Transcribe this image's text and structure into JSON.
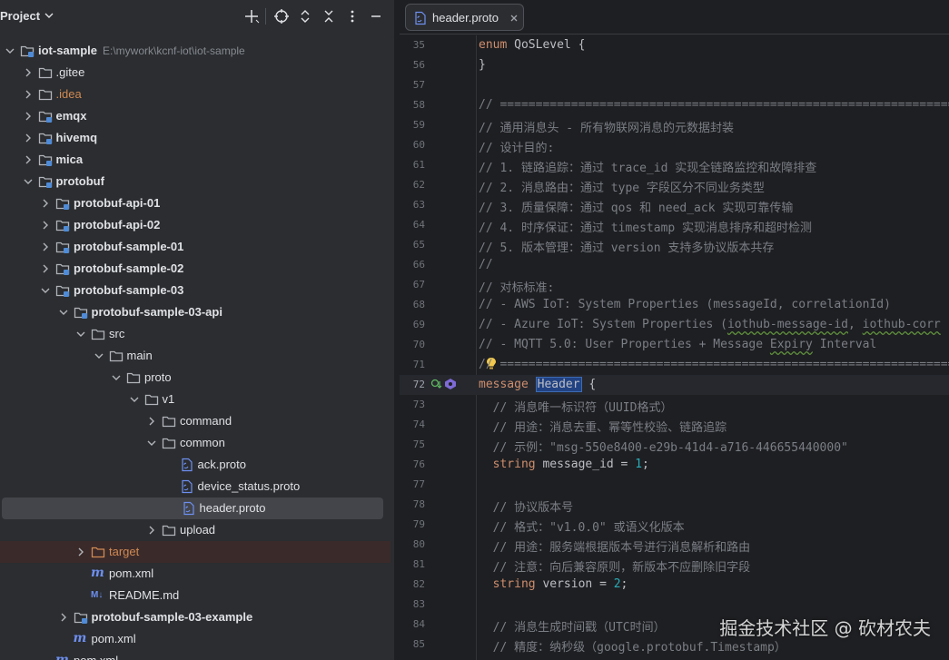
{
  "panel": {
    "title": "Project",
    "header_icons": [
      "plus-icon",
      "crosshair-icon",
      "expand-all-icon",
      "collapse-all-icon",
      "more-icon",
      "minimize-icon"
    ]
  },
  "tree": [
    {
      "label": "iot-sample",
      "path": "E:\\mywork\\kcnf-iot\\iot-sample",
      "depth": 0,
      "chevron": "down",
      "icon": "module-folder",
      "bold": true
    },
    {
      "label": ".gitee",
      "depth": 1,
      "chevron": "right",
      "icon": "folder"
    },
    {
      "label": ".idea",
      "depth": 1,
      "chevron": "right",
      "icon": "folder",
      "color": "#d08a53"
    },
    {
      "label": "emqx",
      "depth": 1,
      "chevron": "right",
      "icon": "module-folder",
      "bold": true
    },
    {
      "label": "hivemq",
      "depth": 1,
      "chevron": "right",
      "icon": "module-folder",
      "bold": true
    },
    {
      "label": "mica",
      "depth": 1,
      "chevron": "right",
      "icon": "module-folder",
      "bold": true
    },
    {
      "label": "protobuf",
      "depth": 1,
      "chevron": "down",
      "icon": "module-folder",
      "bold": true
    },
    {
      "label": "protobuf-api-01",
      "depth": 2,
      "chevron": "right",
      "icon": "module-folder",
      "bold": true
    },
    {
      "label": "protobuf-api-02",
      "depth": 2,
      "chevron": "right",
      "icon": "module-folder",
      "bold": true
    },
    {
      "label": "protobuf-sample-01",
      "depth": 2,
      "chevron": "right",
      "icon": "module-folder",
      "bold": true
    },
    {
      "label": "protobuf-sample-02",
      "depth": 2,
      "chevron": "right",
      "icon": "module-folder",
      "bold": true
    },
    {
      "label": "protobuf-sample-03",
      "depth": 2,
      "chevron": "down",
      "icon": "module-folder",
      "bold": true
    },
    {
      "label": "protobuf-sample-03-api",
      "depth": 3,
      "chevron": "down",
      "icon": "module-folder",
      "bold": true
    },
    {
      "label": "src",
      "depth": 4,
      "chevron": "down",
      "icon": "folder"
    },
    {
      "label": "main",
      "depth": 5,
      "chevron": "down",
      "icon": "folder"
    },
    {
      "label": "proto",
      "depth": 6,
      "chevron": "down",
      "icon": "folder"
    },
    {
      "label": "v1",
      "depth": 7,
      "chevron": "down",
      "icon": "folder"
    },
    {
      "label": "command",
      "depth": 8,
      "chevron": "right",
      "icon": "folder"
    },
    {
      "label": "common",
      "depth": 8,
      "chevron": "down",
      "icon": "folder"
    },
    {
      "label": "ack.proto",
      "depth": 9,
      "chevron": "none",
      "icon": "file"
    },
    {
      "label": "device_status.proto",
      "depth": 9,
      "chevron": "none",
      "icon": "file"
    },
    {
      "label": "header.proto",
      "depth": 9,
      "chevron": "none",
      "icon": "file",
      "selected": true
    },
    {
      "label": "upload",
      "depth": 8,
      "chevron": "right",
      "icon": "folder"
    },
    {
      "label": "target",
      "depth": 4,
      "chevron": "right",
      "icon": "folder-excluded",
      "excluded": true
    },
    {
      "label": "pom.xml",
      "depth": 4,
      "chevron": "none",
      "icon": "maven"
    },
    {
      "label": "README.md",
      "depth": 4,
      "chevron": "none",
      "icon": "markdown"
    },
    {
      "label": "protobuf-sample-03-example",
      "depth": 3,
      "chevron": "right",
      "icon": "module-folder",
      "bold": true
    },
    {
      "label": "pom.xml",
      "depth": 3,
      "chevron": "none",
      "icon": "maven"
    },
    {
      "label": "pom.xml",
      "depth": 2,
      "chevron": "none",
      "icon": "maven"
    }
  ],
  "editor": {
    "tab_label": "header.proto",
    "current_line": "72",
    "lines": [
      {
        "n": "35",
        "parts": [
          [
            "kw",
            "enum"
          ],
          [
            "t",
            " QoSLevel {"
          ]
        ]
      },
      {
        "n": "56",
        "parts": [
          [
            "t",
            "}"
          ]
        ]
      },
      {
        "n": "57",
        "parts": []
      },
      {
        "n": "58",
        "parts": [
          [
            "c",
            "// ================================================================"
          ]
        ]
      },
      {
        "n": "59",
        "parts": [
          [
            "c",
            "// 通用消息头 - 所有物联网消息的元数据封装"
          ]
        ]
      },
      {
        "n": "60",
        "parts": [
          [
            "c",
            "// 设计目的:"
          ]
        ]
      },
      {
        "n": "61",
        "parts": [
          [
            "c",
            "// 1. 链路追踪：通过 trace_id 实现全链路监控和故障排查"
          ]
        ]
      },
      {
        "n": "62",
        "parts": [
          [
            "c",
            "// 2. 消息路由：通过 type 字段区分不同业务类型"
          ]
        ]
      },
      {
        "n": "63",
        "parts": [
          [
            "c",
            "// 3. 质量保障：通过 qos 和 need_ack 实现可靠传输"
          ]
        ]
      },
      {
        "n": "64",
        "parts": [
          [
            "c",
            "// 4. 时序保证：通过 timestamp 实现消息排序和超时检测"
          ]
        ]
      },
      {
        "n": "65",
        "parts": [
          [
            "c",
            "// 5. 版本管理：通过 version 支持多协议版本共存"
          ]
        ]
      },
      {
        "n": "66",
        "parts": [
          [
            "c",
            "//"
          ]
        ]
      },
      {
        "n": "67",
        "parts": [
          [
            "c",
            "// 对标标准:"
          ]
        ]
      },
      {
        "n": "68",
        "parts": [
          [
            "c",
            "// - AWS IoT: System Properties (messageId, correlationId)"
          ]
        ]
      },
      {
        "n": "69",
        "parts": [
          [
            "c",
            "// - Azure IoT: System Properties ("
          ],
          [
            "cs",
            "iothub-message-id"
          ],
          [
            "c",
            ", "
          ],
          [
            "cs",
            "iothub-corr"
          ]
        ]
      },
      {
        "n": "70",
        "parts": [
          [
            "c",
            "// - MQTT 5.0: User Properties + Message "
          ],
          [
            "cs",
            "Expiry"
          ],
          [
            "c",
            " Interval"
          ]
        ]
      },
      {
        "n": "71",
        "parts": [
          [
            "c",
            "// ================================================================"
          ]
        ]
      },
      {
        "n": "72",
        "parts": [
          [
            "kw",
            "message"
          ],
          [
            "t",
            " "
          ],
          [
            "hl",
            "Header"
          ],
          [
            "t",
            " {"
          ]
        ]
      },
      {
        "n": "73",
        "parts": [
          [
            "c",
            "  // 消息唯一标识符（UUID格式）"
          ]
        ]
      },
      {
        "n": "74",
        "parts": [
          [
            "c",
            "  // 用途：消息去重、幂等性校验、链路追踪"
          ]
        ]
      },
      {
        "n": "75",
        "parts": [
          [
            "c",
            "  // 示例：\"msg-550e8400-e29b-41d4-a716-446655440000\""
          ]
        ]
      },
      {
        "n": "76",
        "parts": [
          [
            "kw",
            "  string"
          ],
          [
            "t",
            " message_id = "
          ],
          [
            "num",
            "1"
          ],
          [
            "t",
            ";"
          ]
        ]
      },
      {
        "n": "77",
        "parts": []
      },
      {
        "n": "78",
        "parts": [
          [
            "c",
            "  // 协议版本号"
          ]
        ]
      },
      {
        "n": "79",
        "parts": [
          [
            "c",
            "  // 格式：\"v1.0.0\" 或语义化版本"
          ]
        ]
      },
      {
        "n": "80",
        "parts": [
          [
            "c",
            "  // 用途：服务端根据版本号进行消息解析和路由"
          ]
        ]
      },
      {
        "n": "81",
        "parts": [
          [
            "c",
            "  // 注意：向后兼容原则，新版本不应删除旧字段"
          ]
        ]
      },
      {
        "n": "82",
        "parts": [
          [
            "kw",
            "  string"
          ],
          [
            "t",
            " version = "
          ],
          [
            "num",
            "2"
          ],
          [
            "t",
            ";"
          ]
        ]
      },
      {
        "n": "83",
        "parts": []
      },
      {
        "n": "84",
        "parts": [
          [
            "c",
            "  // 消息生成时间戳（UTC时间）"
          ]
        ]
      },
      {
        "n": "85",
        "parts": [
          [
            "c",
            "  // 精度：纳秒级（google.protobuf.Timestamp）"
          ]
        ]
      }
    ]
  },
  "watermark": "掘金技术社区 @ 砍材农夫",
  "colors": {
    "panel_bg": "#2b2d30",
    "editor_bg": "#1e1f22",
    "folder_icon": "#b1b4ba",
    "module_dot": "#4f8bd6",
    "excluded_folder": "#d08a53",
    "keyword": "#cf8e6d",
    "comment": "#7a7e85",
    "number": "#2aacb8",
    "selection": "#214283"
  }
}
